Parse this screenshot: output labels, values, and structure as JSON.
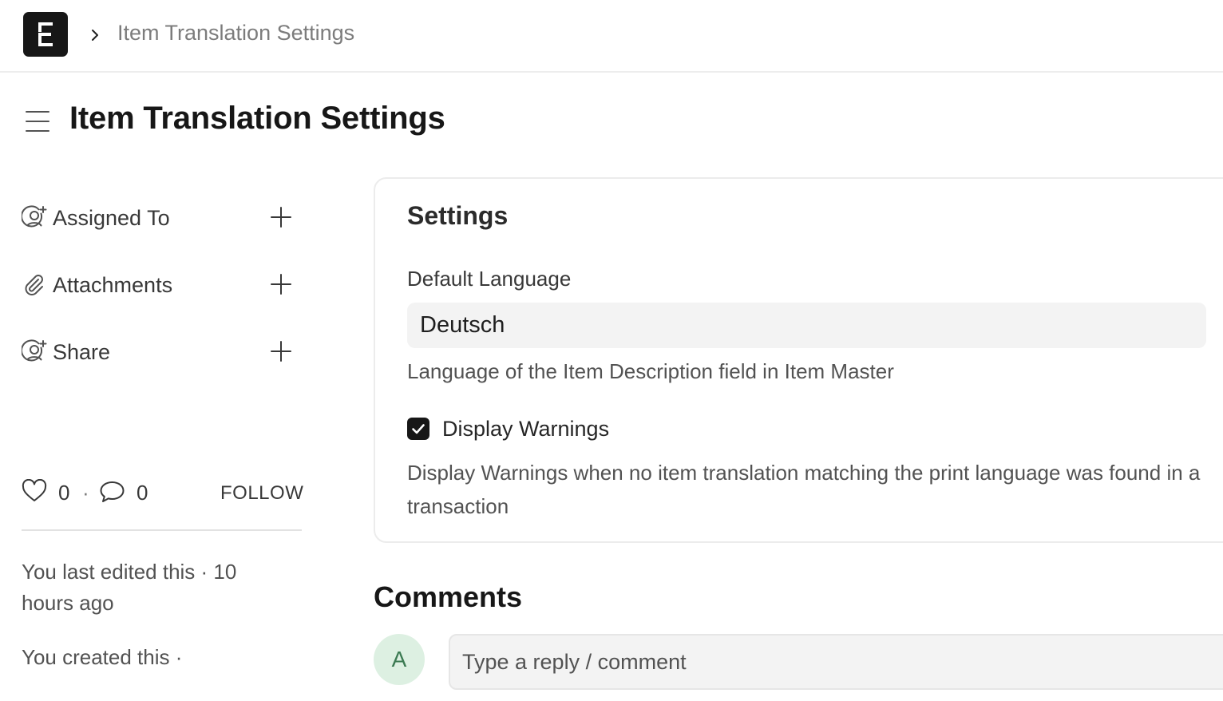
{
  "breadcrumb": {
    "current": "Item Translation Settings"
  },
  "page": {
    "title": "Item Translation Settings"
  },
  "sidebar": {
    "items": [
      {
        "label": "Assigned To",
        "icon": "user-add-icon"
      },
      {
        "label": "Attachments",
        "icon": "paperclip-icon"
      },
      {
        "label": "Share",
        "icon": "user-share-icon"
      }
    ],
    "likes": "0",
    "separator": "·",
    "comments": "0",
    "follow_label": "FOLLOW",
    "timeline": [
      "You last edited this · 10 hours ago",
      "You created this ·"
    ]
  },
  "settings": {
    "title": "Settings",
    "default_language": {
      "label": "Default Language",
      "value": "Deutsch",
      "description": "Language of the Item Description field in Item Master"
    },
    "display_warnings": {
      "label": "Display Warnings",
      "checked": true,
      "description": "Display Warnings when no item translation matching the print language was found in a transaction"
    }
  },
  "comments": {
    "title": "Comments",
    "avatar_initial": "A",
    "placeholder": "Type a reply / comment"
  },
  "colors": {
    "brand": "#171717",
    "avatar_bg": "#ddf0e2",
    "avatar_fg": "#3b7a52",
    "input_bg": "#f3f3f3"
  }
}
